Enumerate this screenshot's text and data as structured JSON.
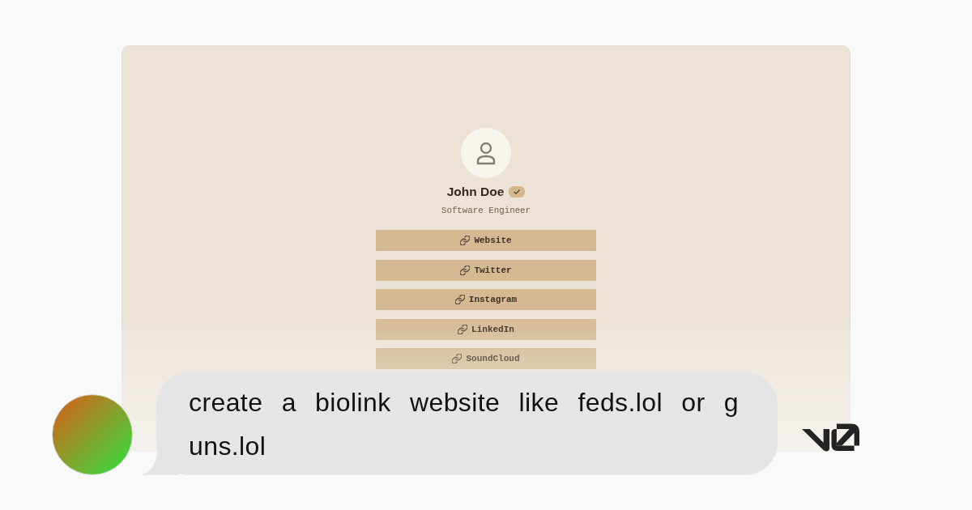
{
  "preview": {
    "profile": {
      "name": "John Doe",
      "verified": true,
      "title": "Software Engineer"
    },
    "links": [
      {
        "label": "Website"
      },
      {
        "label": "Twitter"
      },
      {
        "label": "Instagram"
      },
      {
        "label": "LinkedIn"
      },
      {
        "label": "SoundCloud"
      }
    ]
  },
  "message": {
    "text": "create a biolink website like feds.lol or guns.lol"
  }
}
